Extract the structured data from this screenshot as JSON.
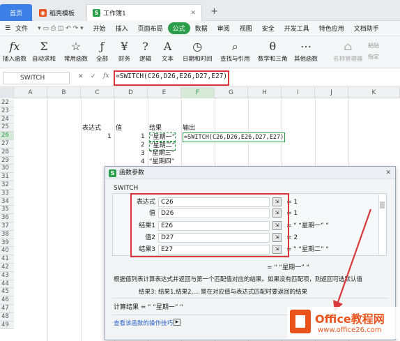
{
  "tabs": {
    "home": "首页",
    "daoke": "稻壳模板",
    "book": "工作簿1",
    "add": "+"
  },
  "menu": {
    "file": "文件",
    "items": [
      "开始",
      "插入",
      "页面布局",
      "公式",
      "数据",
      "审阅",
      "视图",
      "安全",
      "开发工具",
      "特色应用",
      "文档助手"
    ],
    "active_index": 3
  },
  "ribbon": {
    "fx_label": "插入函数",
    "sum_label": "自动求和",
    "common_label": "常用函数",
    "all_label": "全部",
    "finance_label": "财务",
    "logic_label": "逻辑",
    "text_label": "文本",
    "date_label": "日期和时间",
    "lookup_label": "查找与引用",
    "math_label": "数学和三角",
    "other_label": "其他函数",
    "name_mgr_label": "名称管理器",
    "paste_label": "粘贴",
    "specify_label": "指定"
  },
  "formula_bar": {
    "name_box": "SWITCH",
    "fx": "fx",
    "formula": "=SWITCH(C26,D26,E26,D27,E27)"
  },
  "columns": [
    "A",
    "B",
    "C",
    "D",
    "E",
    "F",
    "G",
    "H",
    "I",
    "J",
    "K"
  ],
  "rows": [
    "22",
    "23",
    "24",
    "25",
    "26",
    "27",
    "28",
    "29",
    "30",
    "31",
    "32",
    "33",
    "34",
    "35",
    "36",
    "37",
    "38",
    "39",
    "40",
    "41",
    "42",
    "43",
    "44",
    "45",
    "46",
    "47",
    "48",
    "49"
  ],
  "sheet": {
    "c25": "表达式",
    "d25": "值",
    "e25": "结果",
    "f25": "输出",
    "c26": "1",
    "d26": "1",
    "e26": "“星期一”",
    "f26": "=SWITCH(C26,D26,E26,D27,E27)",
    "d27": "2",
    "e27": "“星期二”",
    "d28": "3",
    "e28": "“星期三”",
    "d29": "4",
    "e29": "“星期四”"
  },
  "dialog": {
    "title": "函数参数",
    "func": "SWITCH",
    "args": [
      {
        "label": "表达式",
        "input": "C26",
        "value": "= 1"
      },
      {
        "label": "值",
        "input": "D26",
        "value": "= 1"
      },
      {
        "label": "结果1",
        "input": "E26",
        "value": "= \" “星期一” \""
      },
      {
        "label": "值2",
        "input": "D27",
        "value": "= 2"
      },
      {
        "label": "结果3",
        "input": "E27",
        "value": "= \" “星期二” \""
      }
    ],
    "result_line": "= \" “星期一” \"",
    "desc": "根据值列表计算表达式并返回与第一个匹配值对应的结果。如果没有匹配项，则返回可选默认值",
    "arg_desc": "结果3:  结果1,结果2,... 是在对应值与表达式匹配时要返回的结果",
    "calc_result": "计算结果 = \" “星期一” \"",
    "help_link": "查看该函数的操作技巧"
  },
  "watermark": {
    "brand": "Office教程网",
    "url": "www.office26.com"
  },
  "colors": {
    "accent_green": "#2a9d48",
    "tab_blue": "#3c7fe6",
    "highlight_red": "#d9383a",
    "brand_orange": "#e8541c"
  }
}
